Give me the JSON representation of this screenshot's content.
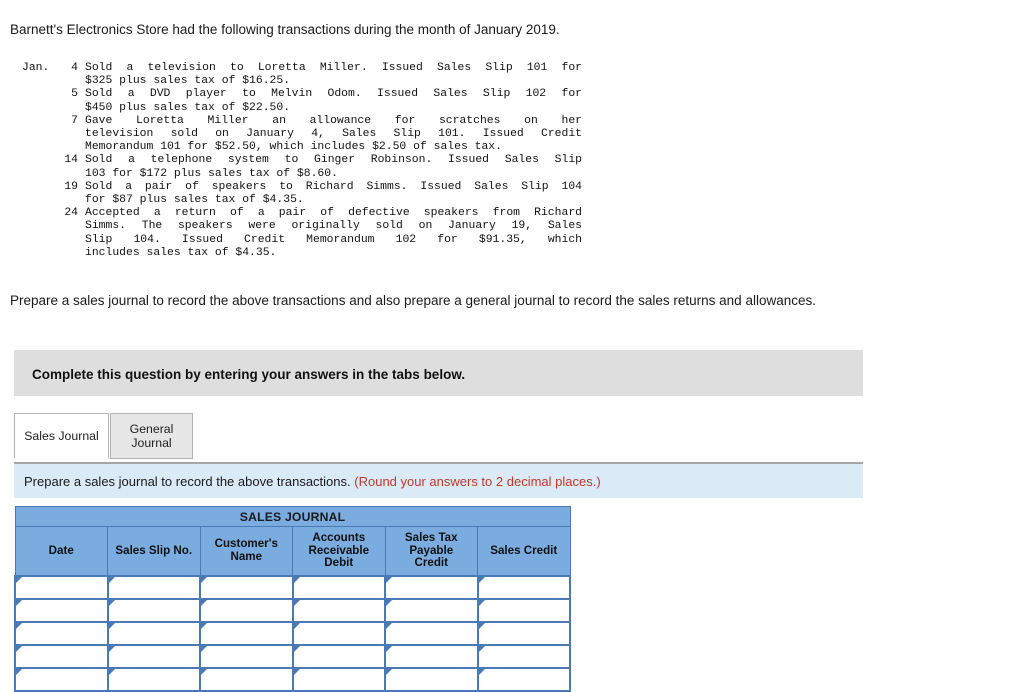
{
  "intro": {
    "text": "Barnett's Electronics Store had the following transactions during the month of January 2019."
  },
  "transactions": {
    "month_label": "Jan.",
    "entries": [
      {
        "day": "4",
        "lines": [
          "Sold a television to Loretta Miller. Issued Sales Slip 101 for",
          "$325 plus sales tax of $16.25."
        ]
      },
      {
        "day": "5",
        "lines": [
          "Sold a DVD player to Melvin Odom. Issued Sales Slip 102 for",
          "$450 plus sales tax of $22.50."
        ]
      },
      {
        "day": "7",
        "lines": [
          "Gave Loretta Miller an allowance for scratches on her",
          "television sold on January 4, Sales Slip 101. Issued Credit",
          "Memorandum 101 for $52.50, which includes $2.50 of sales tax."
        ]
      },
      {
        "day": "14",
        "lines": [
          "Sold a telephone system to Ginger Robinson. Issued Sales Slip",
          "103 for $172 plus sales tax of $8.60."
        ]
      },
      {
        "day": "19",
        "lines": [
          "Sold a pair of speakers to Richard Simms. Issued Sales Slip 104",
          "for $87 plus sales tax of $4.35."
        ]
      },
      {
        "day": "24",
        "lines": [
          "Accepted a return of a pair of defective speakers from Richard",
          "Simms. The speakers were originally sold on January 19, Sales",
          "Slip 104. Issued Credit Memorandum 102 for $91.35, which",
          "includes sales tax of $4.35."
        ]
      }
    ]
  },
  "prepare": {
    "text": "Prepare a sales journal to record the above transactions and also prepare a general journal to record the sales returns and allowances."
  },
  "grey_banner": {
    "text": "Complete this question by entering your answers in the tabs below."
  },
  "tabs": [
    {
      "label": "Sales Journal",
      "active": true
    },
    {
      "label": "General Journal",
      "active": false
    }
  ],
  "blue_bar": {
    "instruction": "Prepare a sales journal to record the above transactions.",
    "round_note": "(Round your answers to 2 decimal places.)"
  },
  "sales_journal": {
    "title": "SALES JOURNAL",
    "columns": [
      "Date",
      "Sales Slip No.",
      "Customer's Name",
      "Accounts Receivable Debit",
      "Sales Tax Payable Credit",
      "Sales Credit"
    ],
    "column_lines": [
      [
        "Date"
      ],
      [
        "Sales Slip No."
      ],
      [
        "Customer's Name"
      ],
      [
        "Accounts",
        "Receivable",
        "Debit"
      ],
      [
        "Sales Tax",
        "Payable",
        "Credit"
      ],
      [
        "Sales Credit"
      ]
    ],
    "rows": [
      [
        "",
        "",
        "",
        "",
        "",
        ""
      ],
      [
        "",
        "",
        "",
        "",
        "",
        ""
      ],
      [
        "",
        "",
        "",
        "",
        "",
        ""
      ],
      [
        "",
        "",
        "",
        "",
        "",
        ""
      ],
      [
        "",
        "",
        "",
        "",
        "",
        ""
      ]
    ]
  },
  "colors": {
    "header_blue": "#7bace0",
    "border_blue": "#4a7ab5",
    "banner_grey": "#dedede",
    "instruction_blue": "#daeaf7",
    "red_note": "#c0392b"
  }
}
